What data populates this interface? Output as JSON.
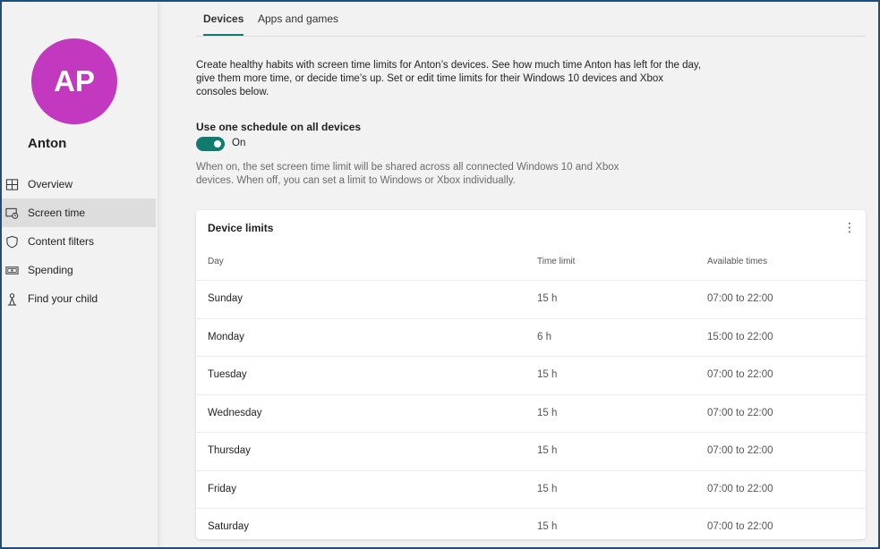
{
  "profile": {
    "initials": "AP",
    "name": "Anton",
    "avatar_color": "#c238be"
  },
  "nav": [
    {
      "label": "Overview",
      "icon": "grid-icon",
      "active": false
    },
    {
      "label": "Screen time",
      "icon": "screen-clock-icon",
      "active": true
    },
    {
      "label": "Content filters",
      "icon": "shield-icon",
      "active": false
    },
    {
      "label": "Spending",
      "icon": "money-icon",
      "active": false
    },
    {
      "label": "Find your child",
      "icon": "person-location-icon",
      "active": false
    }
  ],
  "tabs": [
    {
      "label": "Devices",
      "active": true
    },
    {
      "label": "Apps and games",
      "active": false
    }
  ],
  "intro": "Create healthy habits with screen time limits for Anton’s devices. See how much time Anton has left for the day, give them more time, or decide time’s up. Set or edit time limits for their Windows 10 devices and Xbox consoles below.",
  "schedule": {
    "label": "Use one schedule on all devices",
    "toggle_state": "On",
    "helper": "When on, the set screen time limit will be shared across all connected Windows 10 and Xbox devices. When off, you can set a limit to Windows or Xbox individually."
  },
  "device_limits": {
    "title": "Device limits",
    "columns": [
      "Day",
      "Time limit",
      "Available times"
    ],
    "rows": [
      {
        "day": "Sunday",
        "limit": "15 h",
        "times": "07:00 to 22:00"
      },
      {
        "day": "Monday",
        "limit": "6 h",
        "times": "15:00 to 22:00"
      },
      {
        "day": "Tuesday",
        "limit": "15 h",
        "times": "07:00 to 22:00"
      },
      {
        "day": "Wednesday",
        "limit": "15 h",
        "times": "07:00 to 22:00"
      },
      {
        "day": "Thursday",
        "limit": "15 h",
        "times": "07:00 to 22:00"
      },
      {
        "day": "Friday",
        "limit": "15 h",
        "times": "07:00 to 22:00"
      },
      {
        "day": "Saturday",
        "limit": "15 h",
        "times": "07:00 to 22:00"
      }
    ]
  },
  "colors": {
    "accent": "#107c6f",
    "frame": "#1f4e79"
  }
}
